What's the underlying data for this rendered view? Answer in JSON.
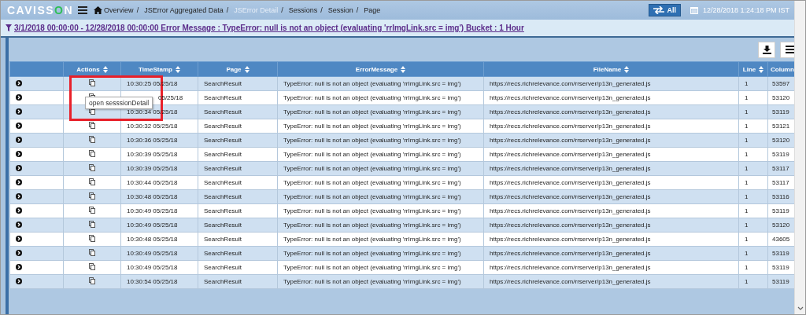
{
  "header": {
    "logo": [
      "CAVISS",
      "O",
      "N"
    ],
    "breadcrumbs": [
      {
        "label": "Overview",
        "home": true,
        "current": false
      },
      {
        "label": "JSError Aggregated Data",
        "home": false,
        "current": false
      },
      {
        "label": "JSError Detail",
        "home": false,
        "current": true
      },
      {
        "label": "Sessions",
        "home": false,
        "current": false
      },
      {
        "label": "Session",
        "home": false,
        "current": false
      },
      {
        "label": "Page",
        "home": false,
        "current": false
      }
    ],
    "separator": "/",
    "all_button": "All",
    "datetime": "12/28/2018 1:24:18 PM IST"
  },
  "filter": "3/1/2018 00:00:00 - 12/28/2018 00:00:00 Error Message : TypeError: null is not an object (evaluating 'rrImgLink.src = img') Bucket : 1 Hour",
  "table": {
    "columns": [
      "",
      "Actions",
      "TimeStamp",
      "Page",
      "ErrorMessage",
      "FileName",
      "Line",
      "Column"
    ],
    "rows": [
      {
        "timestamp": "10:30:25 05/25/18",
        "obscured": false,
        "page": "SearchResult",
        "error": "TypeError: null is not an object (evaluating 'rrImgLink.src = img')",
        "file": "https://recs.richrelevance.com/rrserver/p13n_generated.js",
        "line": "1",
        "column": "53597"
      },
      {
        "timestamp": "05/25/18",
        "obscured": true,
        "page": "SearchResult",
        "error": "TypeError: null is not an object (evaluating 'rrImgLink.src = img')",
        "file": "https://recs.richrelevance.com/rrserver/p13n_generated.js",
        "line": "1",
        "column": "53120"
      },
      {
        "timestamp": "10:30:34 05/25/18",
        "obscured": false,
        "page": "SearchResult",
        "error": "TypeError: null is not an object (evaluating 'rrImgLink.src = img')",
        "file": "https://recs.richrelevance.com/rrserver/p13n_generated.js",
        "line": "1",
        "column": "53119"
      },
      {
        "timestamp": "10:30:32 05/25/18",
        "obscured": false,
        "page": "SearchResult",
        "error": "TypeError: null is not an object (evaluating 'rrImgLink.src = img')",
        "file": "https://recs.richrelevance.com/rrserver/p13n_generated.js",
        "line": "1",
        "column": "53121"
      },
      {
        "timestamp": "10:30:36 05/25/18",
        "obscured": false,
        "page": "SearchResult",
        "error": "TypeError: null is not an object (evaluating 'rrImgLink.src = img')",
        "file": "https://recs.richrelevance.com/rrserver/p13n_generated.js",
        "line": "1",
        "column": "53120"
      },
      {
        "timestamp": "10:30:39 05/25/18",
        "obscured": false,
        "page": "SearchResult",
        "error": "TypeError: null is not an object (evaluating 'rrImgLink.src = img')",
        "file": "https://recs.richrelevance.com/rrserver/p13n_generated.js",
        "line": "1",
        "column": "53119"
      },
      {
        "timestamp": "10:30:39 05/25/18",
        "obscured": false,
        "page": "SearchResult",
        "error": "TypeError: null is not an object (evaluating 'rrImgLink.src = img')",
        "file": "https://recs.richrelevance.com/rrserver/p13n_generated.js",
        "line": "1",
        "column": "53117"
      },
      {
        "timestamp": "10:30:44 05/25/18",
        "obscured": false,
        "page": "SearchResult",
        "error": "TypeError: null is not an object (evaluating 'rrImgLink.src = img')",
        "file": "https://recs.richrelevance.com/rrserver/p13n_generated.js",
        "line": "1",
        "column": "53117"
      },
      {
        "timestamp": "10:30:48 05/25/18",
        "obscured": false,
        "page": "SearchResult",
        "error": "TypeError: null is not an object (evaluating 'rrImgLink.src = img')",
        "file": "https://recs.richrelevance.com/rrserver/p13n_generated.js",
        "line": "1",
        "column": "53116"
      },
      {
        "timestamp": "10:30:49 05/25/18",
        "obscured": false,
        "page": "SearchResult",
        "error": "TypeError: null is not an object (evaluating 'rrImgLink.src = img')",
        "file": "https://recs.richrelevance.com/rrserver/p13n_generated.js",
        "line": "1",
        "column": "53119"
      },
      {
        "timestamp": "10:30:49 05/25/18",
        "obscured": false,
        "page": "SearchResult",
        "error": "TypeError: null is not an object (evaluating 'rrImgLink.src = img')",
        "file": "https://recs.richrelevance.com/rrserver/p13n_generated.js",
        "line": "1",
        "column": "53120"
      },
      {
        "timestamp": "10:30:48 05/25/18",
        "obscured": false,
        "page": "SearchResult",
        "error": "TypeError: null is not an object (evaluating 'rrImgLink.src = img')",
        "file": "https://recs.richrelevance.com/rrserver/p13n_generated.js",
        "line": "1",
        "column": "43605"
      },
      {
        "timestamp": "10:30:49 05/25/18",
        "obscured": false,
        "page": "SearchResult",
        "error": "TypeError: null is not an object (evaluating 'rrImgLink.src = img')",
        "file": "https://recs.richrelevance.com/rrserver/p13n_generated.js",
        "line": "1",
        "column": "53119"
      },
      {
        "timestamp": "10:30:49 05/25/18",
        "obscured": false,
        "page": "SearchResult",
        "error": "TypeError: null is not an object (evaluating 'rrImgLink.src = img')",
        "file": "https://recs.richrelevance.com/rrserver/p13n_generated.js",
        "line": "1",
        "column": "53119"
      },
      {
        "timestamp": "10:30:54 05/25/18",
        "obscured": false,
        "page": "SearchResult",
        "error": "TypeError: null is not an object (evaluating 'rrImgLink.src = img')",
        "file": "https://recs.richrelevance.com/rrserver/p13n_generated.js",
        "line": "1",
        "column": "53119"
      }
    ]
  },
  "tooltip": "open sesssionDetail"
}
